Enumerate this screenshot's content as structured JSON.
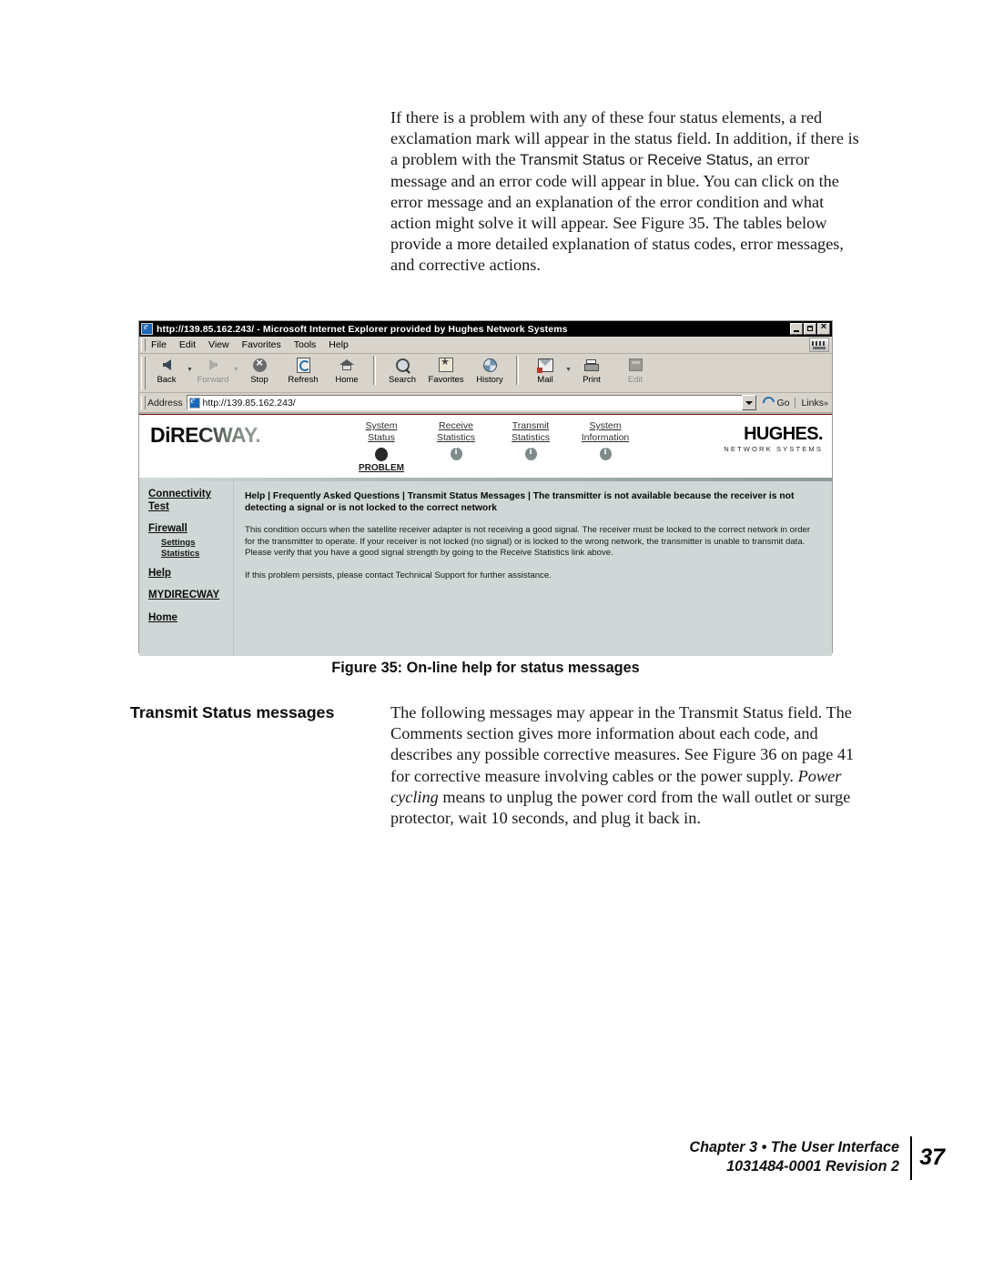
{
  "intro_paragraph": {
    "part1": "If there is a problem with any of these four status elements, a red exclamation mark will appear in the status field. In addition, if there is a problem with the ",
    "emph1": "Transmit Status",
    "mid": " or ",
    "emph2": "Receive Status",
    "part2": ", an error message and an error code will appear in blue. You can click on the error message and an explanation of the error condition and what action might solve it will appear. See Figure 35. The tables below provide a more detailed explanation of status codes, error messages, and corrective actions."
  },
  "browser": {
    "title": "http://139.85.162.243/ - Microsoft Internet Explorer provided by Hughes Network Systems",
    "window_buttons": {
      "minimize": "minimize-button",
      "maximize": "restore-button",
      "close": "close-button"
    },
    "menus": [
      "File",
      "Edit",
      "View",
      "Favorites",
      "Tools",
      "Help"
    ],
    "toolbar": [
      {
        "label": "Back",
        "icon": "back-arrow-icon",
        "enabled": true,
        "dropdown": true
      },
      {
        "label": "Forward",
        "icon": "forward-arrow-icon",
        "enabled": false,
        "dropdown": true
      },
      {
        "label": "Stop",
        "icon": "stop-icon",
        "enabled": true,
        "dropdown": false
      },
      {
        "label": "Refresh",
        "icon": "refresh-icon",
        "enabled": true,
        "dropdown": false
      },
      {
        "label": "Home",
        "icon": "home-icon",
        "enabled": true,
        "dropdown": false
      },
      {
        "label": "Search",
        "icon": "search-icon",
        "enabled": true,
        "dropdown": false
      },
      {
        "label": "Favorites",
        "icon": "favorites-star-icon",
        "enabled": true,
        "dropdown": false
      },
      {
        "label": "History",
        "icon": "history-clock-icon",
        "enabled": true,
        "dropdown": false
      },
      {
        "label": "Mail",
        "icon": "mail-icon",
        "enabled": true,
        "dropdown": true
      },
      {
        "label": "Print",
        "icon": "printer-icon",
        "enabled": true,
        "dropdown": false
      },
      {
        "label": "Edit",
        "icon": "edit-icon",
        "enabled": false,
        "dropdown": false
      }
    ],
    "address": {
      "label": "Address",
      "url": "http://139.85.162.243/",
      "go_label": "Go",
      "links_label": "Links"
    }
  },
  "web_page": {
    "brand_left": "DiRECWAY.",
    "brand_right_main": "HUGHES.",
    "brand_right_sub": "NETWORK SYSTEMS",
    "nav": [
      {
        "line1": "System",
        "line2": "Status",
        "icon": "status-problem-dot-icon",
        "status_word": "PROBLEM"
      },
      {
        "line1": "Receive",
        "line2": "Statistics",
        "icon": "info-dot-icon",
        "status_word": ""
      },
      {
        "line1": "Transmit",
        "line2": "Statistics",
        "icon": "info-dot-icon",
        "status_word": ""
      },
      {
        "line1": "System",
        "line2": "Information",
        "icon": "info-dot-icon",
        "status_word": ""
      }
    ],
    "sidebar": [
      {
        "type": "link",
        "label": "Connectivity Test"
      },
      {
        "type": "link",
        "label": "Firewall",
        "tight": true
      },
      {
        "type": "sub",
        "label": "Settings"
      },
      {
        "type": "sub",
        "label": "Statistics"
      },
      {
        "type": "gap"
      },
      {
        "type": "link",
        "label": "Help"
      },
      {
        "type": "link",
        "label": "MYDIRECWAY"
      },
      {
        "type": "link",
        "label": "Home"
      }
    ],
    "breadcrumb": "Help | Frequently Asked Questions | Transmit Status Messages | The transmitter is not available because the receiver is not detecting a signal or is not locked to the correct network",
    "paragraphs": [
      "This condition occurs when the satellite receiver adapter is not receiving a good signal. The receiver must be locked to the correct network in order for the transmitter to operate. If your receiver is not locked (no signal) or is locked to the wrong network, the transmitter is unable to transmit data. Please verify that you have a good signal strength by going to the Receive Statistics link above.",
      "If this problem persists, please contact Technical Support for further assistance."
    ]
  },
  "figure_caption": "Figure 35:  On-line help for status messages",
  "section": {
    "heading": "Transmit Status messages",
    "body_part1": "The following messages may appear in the Transmit Status field. The Comments section gives more information about each code, and describes any possible corrective measures. See Figure 36 on page 41 for corrective measure involving cables or the power supply. ",
    "body_emph": "Power cycling",
    "body_part2": " means to unplug the power cord from the wall outlet or surge protector, wait 10 seconds, and plug it back in."
  },
  "footer": {
    "line1": "Chapter 3 • The User Interface",
    "line2": "1031484-0001  Revision 2",
    "page_number": "37"
  }
}
